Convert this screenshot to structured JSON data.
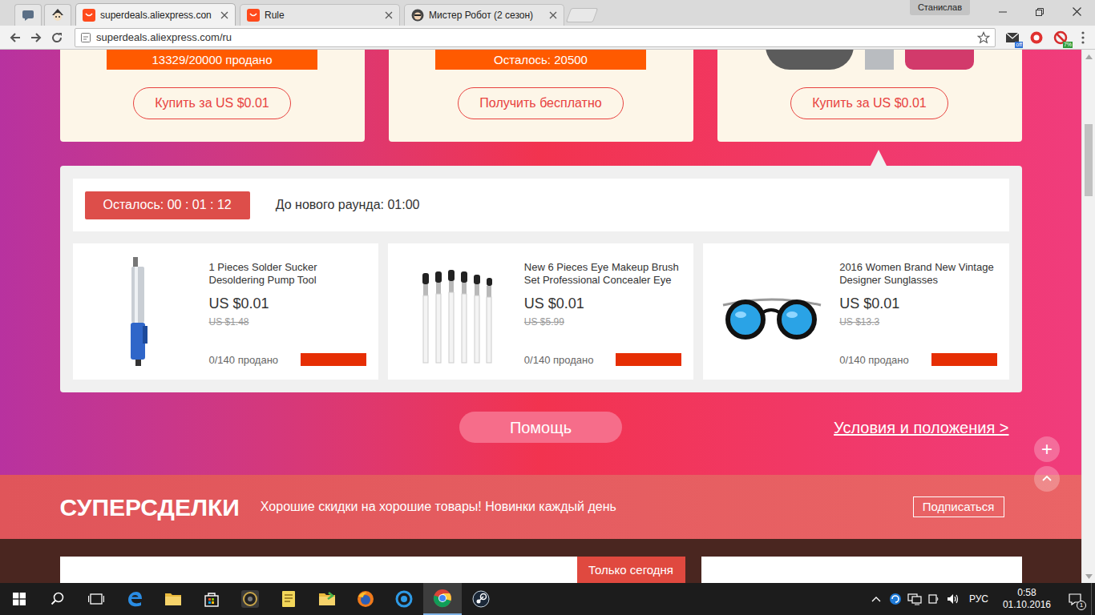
{
  "browser": {
    "tabs": [
      {
        "label": "superdeals.aliexpress.con",
        "selected": true,
        "kind": "aliexpress"
      },
      {
        "label": "Rule",
        "selected": false,
        "kind": "aliexpress"
      },
      {
        "label": "Мистер Робот (2 сезон)",
        "selected": false,
        "kind": "avatar"
      }
    ],
    "profile": "Станислав",
    "address": "superdeals.aliexpress.com/ru",
    "extension_badges": [
      "off",
      "7%"
    ]
  },
  "deals": [
    {
      "kind": "progress",
      "status": "13329/20000 продано",
      "button": "Купить за US $0.01",
      "selected": false
    },
    {
      "kind": "progress",
      "status": "Осталось: 20500",
      "button": "Получить бесплатно",
      "selected": false
    },
    {
      "kind": "images",
      "button": "Купить за US $0.01",
      "selected": true
    }
  ],
  "round": {
    "timer": "Осталось: 00 : 01 : 12",
    "next": "До нового раунда: 01:00"
  },
  "products": [
    {
      "kind": "pump",
      "title": "1 Pieces Solder Sucker Desoldering Pump Tool",
      "price": "US $0.01",
      "old_price": "US $1.48",
      "sold": "0/140 продано"
    },
    {
      "kind": "brushes",
      "title": "New 6 Pieces Eye Makeup Brush Set Professional Concealer Eye",
      "price": "US $0.01",
      "old_price": "US $5.99",
      "sold": "0/140 продано"
    },
    {
      "kind": "sunglasses",
      "title": "2016 Women Brand New Vintage Designer Sunglasses",
      "price": "US $0.01",
      "old_price": "US $13.3",
      "sold": "0/140 продано"
    }
  ],
  "help_button": "Помощь",
  "terms_link": "Условия и положения >",
  "float_plus": "+",
  "banner": {
    "title": "СУПЕРСДЕЛКИ",
    "subtitle": "Хорошие скидки на хорошие товары! Новинки каждый день",
    "button": "Подписаться"
  },
  "today_tag": "Только сегодня",
  "taskbar": {
    "apps": [
      {
        "kind": "start",
        "active": false
      },
      {
        "kind": "search",
        "active": false
      },
      {
        "kind": "taskview",
        "active": false
      },
      {
        "kind": "edge",
        "active": false
      },
      {
        "kind": "explorer",
        "active": false
      },
      {
        "kind": "store",
        "active": false
      },
      {
        "kind": "speaker",
        "active": false
      },
      {
        "kind": "notes",
        "active": false
      },
      {
        "kind": "folder",
        "active": false
      },
      {
        "kind": "firefox",
        "active": false
      },
      {
        "kind": "blueapp",
        "active": false
      },
      {
        "kind": "chrome",
        "active": true
      },
      {
        "kind": "steam",
        "active": false
      }
    ],
    "language": "РУС",
    "time": "0:58",
    "date": "01.10.2016",
    "notifications": "1"
  }
}
